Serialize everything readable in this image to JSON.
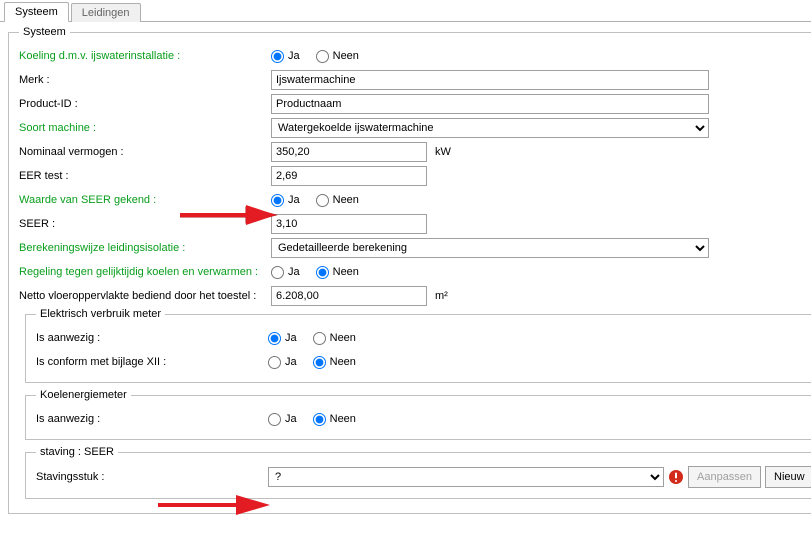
{
  "tabs": {
    "systeem": "Systeem",
    "leidingen": "Leidingen"
  },
  "fieldset_title": "Systeem",
  "rows": {
    "koeling": "Koeling d.m.v. ijswaterinstallatie :",
    "merk": "Merk :",
    "productid": "Product-ID :",
    "soort": "Soort machine :",
    "nominaal": "Nominaal vermogen :",
    "eertest": "EER test :",
    "seer_known": "Waarde van SEER gekend :",
    "seer": "SEER :",
    "bereken": "Berekeningswijze leidingsisolatie :",
    "regeling": "Regeling tegen gelijktijdig koelen en verwarmen :",
    "netto": "Netto vloeroppervlakte bediend door het toestel :",
    "elek_title": "Elektrisch verbruik meter",
    "aanwezig": "Is aanwezig :",
    "conform": "Is conform met bijlage XII :",
    "koel_title": "Koelenergiemeter",
    "staving_title": "staving : SEER",
    "stavingsstuk": "Stavingsstuk :"
  },
  "values": {
    "merk": "Ijswatermachine",
    "productid": "Productnaam",
    "soort": "Watergekoelde ijswatermachine",
    "nominaal": "350,20",
    "nominaal_unit": "kW",
    "eertest": "2,69",
    "seer": "3,10",
    "bereken": "Gedetailleerde berekening",
    "netto": "6.208,00",
    "netto_unit": "m²",
    "stavingsstuk": "?"
  },
  "radio": {
    "ja": "Ja",
    "neen": "Neen"
  },
  "buttons": {
    "aanpassen": "Aanpassen",
    "nieuw": "Nieuw"
  }
}
